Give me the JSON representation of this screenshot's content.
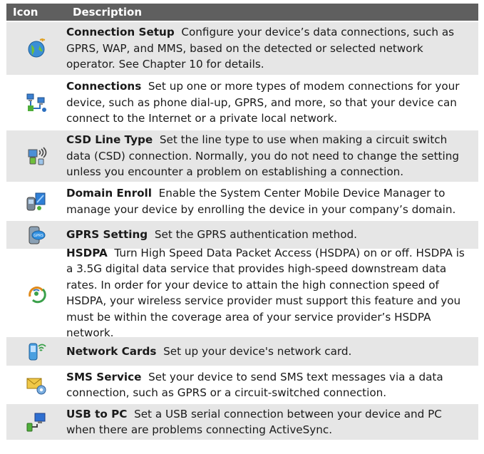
{
  "header": {
    "col_icon": "Icon",
    "col_description": "Description"
  },
  "rows": [
    {
      "icon": "globe-signal-icon",
      "title": "Connection Setup",
      "text": "Configure your device’s data connections, such as GPRS, WAP, and MMS, based on the detected or selected network operator. See Chapter 10 for details."
    },
    {
      "icon": "network-computers-icon",
      "title": "Connections",
      "text": "Set up one or more types of modem connections for your device, such as phone dial-up, GPRS, and more, so that your device can connect to the Internet or a private local network."
    },
    {
      "icon": "phone-signal-icon",
      "title": "CSD Line Type",
      "text": "Set the line type to use when making a circuit switch data (CSD) connection. Normally, you do not need to change the setting unless you encounter a problem on establishing a connection."
    },
    {
      "icon": "domain-enroll-icon",
      "title": "Domain Enroll",
      "text": "Enable the System Center Mobile Device Manager to manage your device by enrolling the device in your company’s domain."
    },
    {
      "icon": "gprs-phone-icon",
      "title": "GPRS Setting",
      "text": "Set the GPRS authentication method."
    },
    {
      "icon": "hsdpa-signal-icon",
      "title": "HSDPA",
      "text": "Turn High Speed Data Packet Access (HSDPA) on or off. HSDPA is a 3.5G digital data service that provides high-speed downstream data rates. In order for your device to attain the high connection speed of HSDPA, your wireless service provider must support this feature and you must be within the coverage area of your service provider’s HSDPA network."
    },
    {
      "icon": "network-card-icon",
      "title": "Network Cards",
      "text": "Set up your device's network card."
    },
    {
      "icon": "sms-envelope-gear-icon",
      "title": "SMS Service",
      "text": "Set your device to send SMS text messages via a data connection, such as GPRS or a circuit-switched connection."
    },
    {
      "icon": "usb-pc-icon",
      "title": "USB to PC",
      "text": "Set a USB serial connection between your device and PC when there are problems connecting ActiveSync."
    }
  ]
}
